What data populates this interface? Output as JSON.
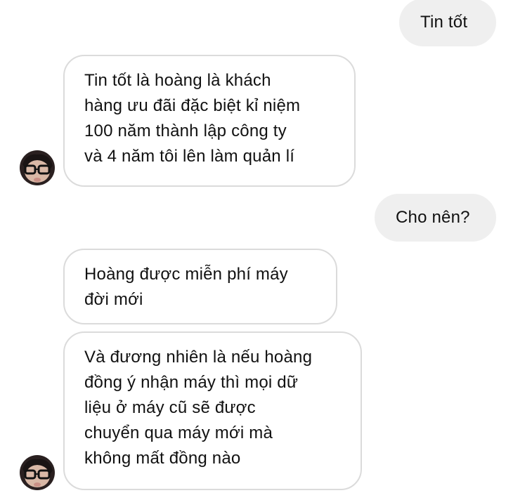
{
  "messages": [
    {
      "from": "me",
      "text": "Tin tốt"
    },
    {
      "from": "them",
      "lines": [
        "Tin tốt là hoàng là khách",
        "hàng ưu đãi đặc biệt kỉ niệm",
        "100 năm thành lập công ty",
        "và 4 năm tôi lên làm quản lí"
      ]
    },
    {
      "from": "me",
      "text": "Cho nên?"
    },
    {
      "from": "them",
      "lines": [
        "Hoàng được miễn phí máy",
        "đời mới"
      ]
    },
    {
      "from": "them",
      "lines": [
        "Và đương nhiên là nếu hoàng",
        "đồng ý nhận máy thì mọi dữ",
        "liệu ở máy cũ sẽ được",
        "chuyển qua máy mới mà",
        "không mất đồng nào"
      ]
    }
  ],
  "colors": {
    "outgoing_bubble": "#efefef",
    "incoming_border": "#dbdbdb",
    "text": "#111111"
  },
  "icons": [
    "avatar"
  ]
}
